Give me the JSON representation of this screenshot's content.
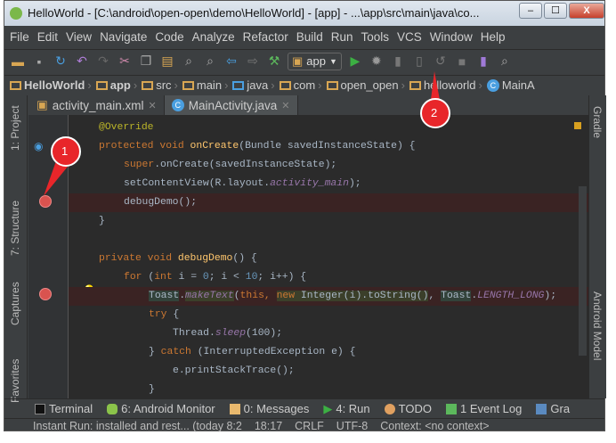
{
  "window": {
    "title": "HelloWorld - [C:\\android\\open-open\\demo\\HelloWorld] - [app] - ...\\app\\src\\main\\java\\co...",
    "minimize": "–",
    "maximize": "☐",
    "close": "X"
  },
  "menu": [
    "File",
    "Edit",
    "View",
    "Navigate",
    "Code",
    "Analyze",
    "Refactor",
    "Build",
    "Run",
    "Tools",
    "VCS",
    "Window",
    "Help"
  ],
  "toolbar": {
    "run_config": "app"
  },
  "breadcrumbs": [
    "HelloWorld",
    "app",
    "src",
    "main",
    "java",
    "com",
    "open_open",
    "helloworld",
    "MainA"
  ],
  "tabs": [
    {
      "label": "activity_main.xml",
      "active": false
    },
    {
      "label": "MainActivity.java",
      "active": true
    }
  ],
  "left_tools": [
    "1: Project",
    "7: Structure",
    "Captures",
    "Favorites"
  ],
  "right_tools": [
    "Gradle",
    "Android Model"
  ],
  "bottom_tools": [
    "Terminal",
    "6: Android Monitor",
    "0: Messages",
    "4: Run",
    "TODO",
    "1 Event Log",
    "Gra"
  ],
  "status": {
    "message": "Instant Run: installed and rest... (today 8:2",
    "position": "18:17",
    "line_sep": "CRLF",
    "encoding": "UTF-8",
    "context": "Context: <no context>"
  },
  "callouts": [
    "1",
    "2"
  ],
  "code": {
    "l1": "@Override",
    "l2a": "protected void ",
    "l2b": "onCreate",
    "l2c": "(Bundle savedInstanceState) {",
    "l3a": "super",
    "l3b": ".onCreate(savedInstanceState);",
    "l4a": "setContentView(R.layout.",
    "l4b": "activity_main",
    "l4c": ");",
    "l5": "debugDemo();",
    "l6": "}",
    "l8a": "private void ",
    "l8b": "debugDemo",
    "l8c": "() {",
    "l9a": "for ",
    "l9b": "(",
    "l9c": "int ",
    "l9d": "i = ",
    "l9e": "0",
    "l9f": "; i < ",
    "l9g": "10",
    "l9h": "; i++) {",
    "l10a": "Toast",
    "l10b": ".",
    "l10c": "makeText",
    "l10d": "(",
    "l10e": "this, ",
    "l10f": "new ",
    "l10g": "Integer(i).toString()",
    "l10h": ", ",
    "l10i": "Toast",
    "l10j": ".",
    "l10k": "LENGTH_LONG",
    "l10l": ");",
    "l11a": "try ",
    "l11b": "{",
    "l12a": "Thread.",
    "l12b": "sleep",
    "l12c": "(100);",
    "l13a": "} ",
    "l13b": "catch ",
    "l13c": "(InterruptedException e) {",
    "l14": "e.printStackTrace();",
    "l15": "}"
  },
  "colors": {
    "keyword": "#cc7832",
    "annotation": "#bbb529",
    "text": "#a9b7c6",
    "field": "#9876aa",
    "number": "#6897bb",
    "breakpoint": "#d9534f",
    "callout": "#e8262a"
  }
}
